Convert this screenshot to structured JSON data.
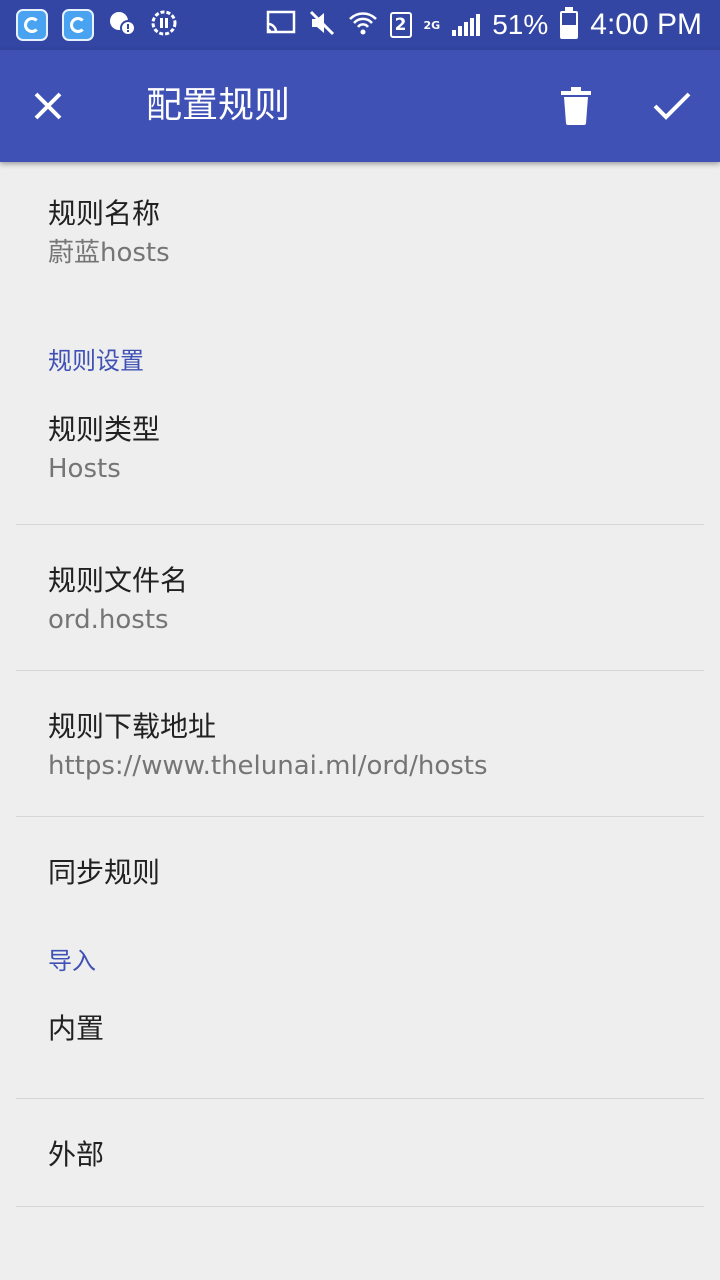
{
  "status_bar": {
    "sim_slot": "2",
    "network": "2G",
    "battery_percent": "51%",
    "battery_level": 0.51,
    "time": "4:00 PM",
    "icons": [
      "app-icon",
      "app-icon",
      "notification-icon",
      "sync-icon",
      "cast-icon",
      "mute-icon",
      "wifi-icon",
      "sim-icon",
      "signal-icon",
      "battery-icon"
    ]
  },
  "app_bar": {
    "title": "配置规则",
    "close_icon": "close-icon",
    "delete_icon": "delete-icon",
    "done_icon": "check-icon"
  },
  "rule_name": {
    "title": "规则名称",
    "summary": "蔚蓝hosts"
  },
  "rule_settings": {
    "header": "规则设置",
    "type": {
      "title": "规则类型",
      "summary": "Hosts"
    },
    "filename": {
      "title": "规则文件名",
      "summary": "ord.hosts"
    },
    "download_url": {
      "title": "规则下载地址",
      "summary": "https://www.thelunai.ml/ord/hosts"
    },
    "sync": {
      "title": "同步规则"
    }
  },
  "import": {
    "header": "导入",
    "builtin": {
      "title": "内置"
    },
    "external": {
      "title": "外部"
    }
  },
  "colors": {
    "status_bar": "#3346a3",
    "app_bar": "#3f51b5",
    "accent": "#3f51b5",
    "background": "#eeeeee"
  }
}
